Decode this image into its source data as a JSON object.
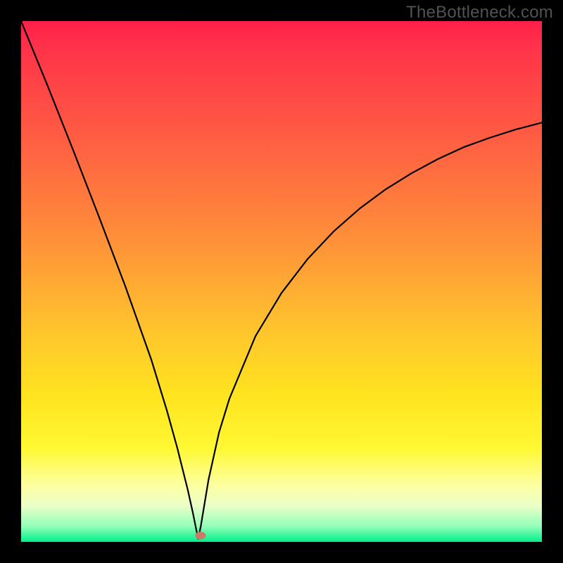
{
  "watermark": "TheBottleneck.com",
  "colors": {
    "frame": "#000000",
    "watermark": "#525252",
    "curve_stroke": "#000000",
    "marker_fill": "#c97b68",
    "gradient_stops": [
      {
        "pos": 0.0,
        "hex": "#ff1f4a"
      },
      {
        "pos": 0.05,
        "hex": "#ff3249"
      },
      {
        "pos": 0.2,
        "hex": "#ff5744"
      },
      {
        "pos": 0.4,
        "hex": "#ff8a3a"
      },
      {
        "pos": 0.58,
        "hex": "#ffc12e"
      },
      {
        "pos": 0.72,
        "hex": "#ffe41f"
      },
      {
        "pos": 0.82,
        "hex": "#fff833"
      },
      {
        "pos": 0.89,
        "hex": "#fdffa0"
      },
      {
        "pos": 0.93,
        "hex": "#ecffc8"
      },
      {
        "pos": 0.97,
        "hex": "#93ffb9"
      },
      {
        "pos": 1.0,
        "hex": "#00ef8c"
      }
    ]
  },
  "chart_data": {
    "type": "line",
    "title": "",
    "xlabel": "",
    "ylabel": "",
    "xlim": [
      0,
      1
    ],
    "ylim": [
      0,
      1
    ],
    "notch_x": 0.34,
    "series": [
      {
        "name": "curve",
        "comment": "V-shaped curve; y normalized 0=bottom 1=top; values estimated from pixels",
        "x": [
          0.0,
          0.05,
          0.1,
          0.15,
          0.2,
          0.25,
          0.28,
          0.3,
          0.32,
          0.33,
          0.335,
          0.34,
          0.345,
          0.35,
          0.36,
          0.38,
          0.4,
          0.45,
          0.5,
          0.55,
          0.6,
          0.65,
          0.7,
          0.75,
          0.8,
          0.85,
          0.9,
          0.95,
          1.0
        ],
        "y": [
          1.0,
          0.878,
          0.752,
          0.623,
          0.491,
          0.35,
          0.252,
          0.18,
          0.1,
          0.055,
          0.03,
          0.006,
          0.03,
          0.06,
          0.12,
          0.21,
          0.275,
          0.395,
          0.478,
          0.543,
          0.596,
          0.64,
          0.677,
          0.708,
          0.735,
          0.758,
          0.776,
          0.792,
          0.805
        ]
      }
    ],
    "marker": {
      "x": 0.345,
      "y": 0.012
    }
  }
}
